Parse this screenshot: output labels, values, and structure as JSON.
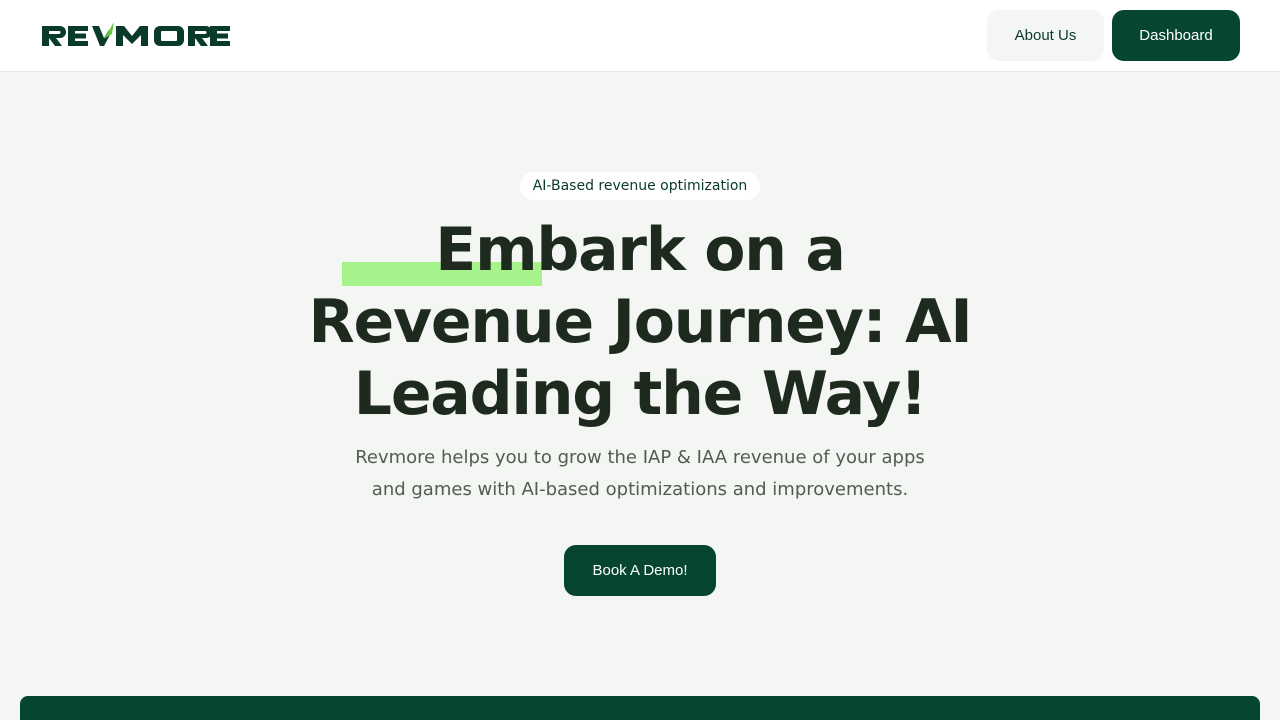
{
  "header": {
    "logo_text": "REVMORE",
    "about_label": "About Us",
    "dashboard_label": "Dashboard"
  },
  "hero": {
    "badge": "AI-Based revenue optimization",
    "headline": "Embark on a Revenue Journey: AI Leading the Way!",
    "subtitle": "Revmore helps you to grow the IAP & IAA revenue of your apps and games with AI-based optimizations and improvements.",
    "cta_label": "Book A Demo!"
  },
  "colors": {
    "brand_dark": "#064530",
    "accent_green": "#a6f38c",
    "page_bg": "#f3f6f2"
  }
}
